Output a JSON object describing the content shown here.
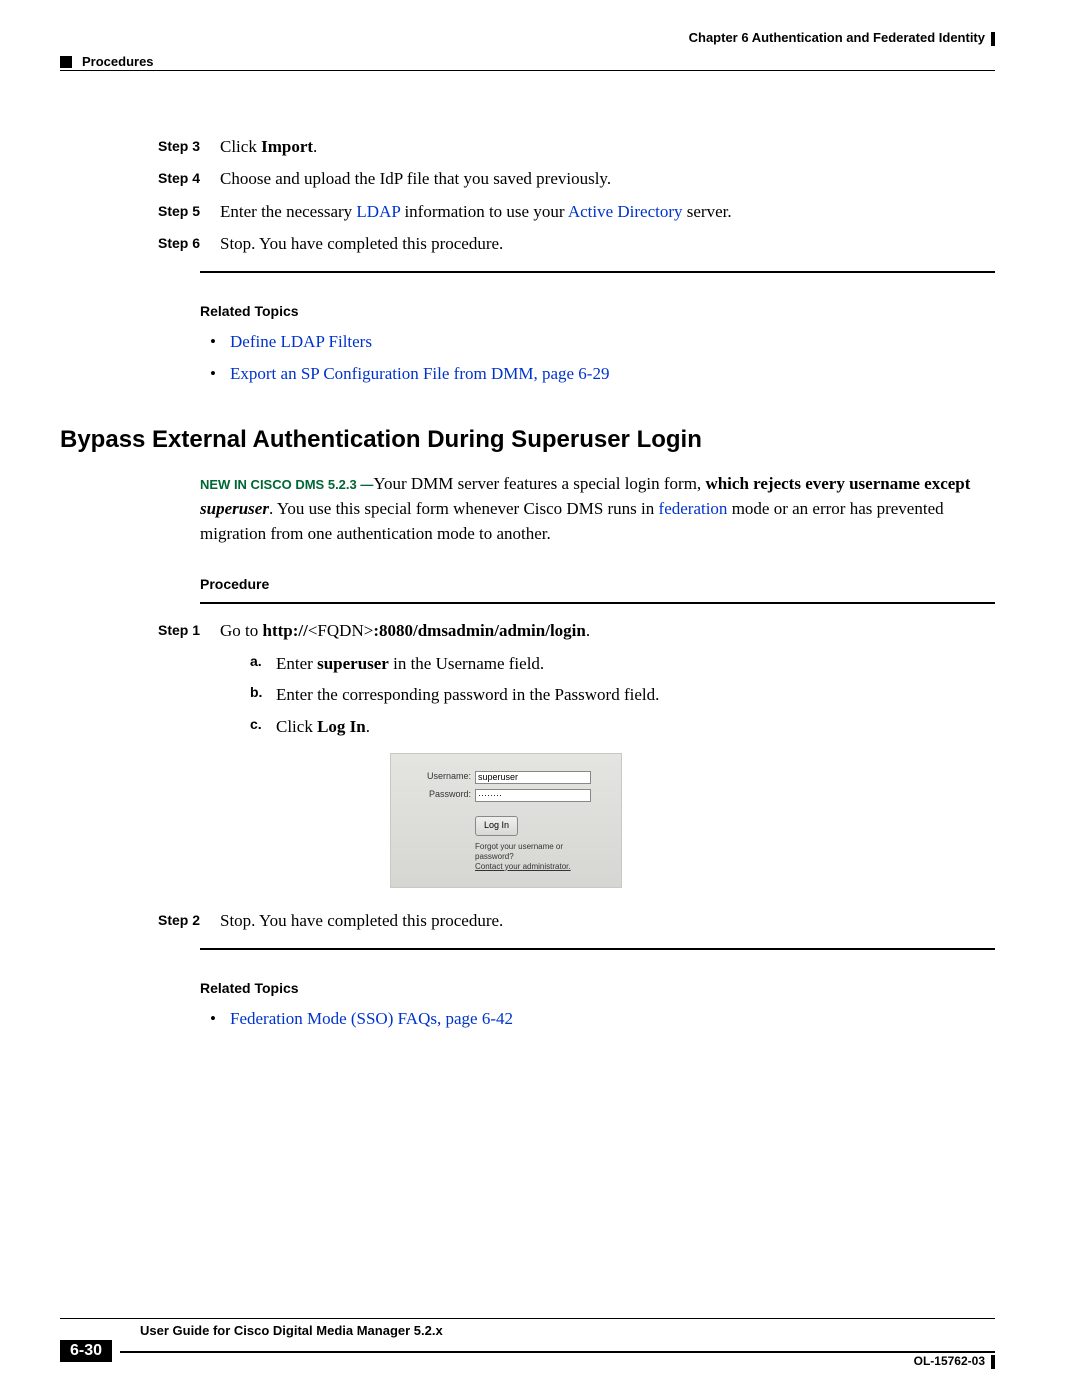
{
  "header": {
    "chapter": "Chapter 6      Authentication and Federated Identity",
    "section": "Procedures"
  },
  "steps_top": [
    {
      "label": "Step 3",
      "text": "Click ",
      "bold": "Import",
      "after": "."
    },
    {
      "label": "Step 4",
      "text": "Choose and upload the IdP file that you saved previously."
    },
    {
      "label": "Step 5",
      "text": "Enter the necessary ",
      "link1": "LDAP",
      "mid": " information to use your ",
      "link2": "Active Directory",
      "after": " server."
    },
    {
      "label": "Step 6",
      "text": "Stop. You have completed this procedure."
    }
  ],
  "related1": {
    "heading": "Related Topics",
    "items": [
      "Define LDAP Filters",
      "Export an SP Configuration File from DMM, page 6-29"
    ]
  },
  "section_title": "Bypass External Authentication During Superuser Login",
  "intro": {
    "new_tag": "NEW IN CISCO DMS 5.2.3 —",
    "t1": "Your DMM server features a special login form, ",
    "b1": "which rejects every username except ",
    "bi1": "superuser",
    "t2": ". You use this special form whenever Cisco DMS runs in ",
    "link": "federation",
    "t3": " mode or an error has prevented migration from one authentication mode to another."
  },
  "procedure_heading": "Procedure",
  "step1": {
    "label": "Step 1",
    "pre": "Go to ",
    "bold1": "http://",
    "plain": "<FQDN>",
    "bold2": ":8080/dmsadmin/admin/login",
    "after": ".",
    "sub": [
      {
        "m": "a.",
        "t1": "Enter ",
        "b": "superuser",
        "t2": " in the Username field."
      },
      {
        "m": "b.",
        "t1": "Enter the corresponding password in the Password field."
      },
      {
        "m": "c.",
        "t1": "Click ",
        "b": "Log In",
        "t2": "."
      }
    ]
  },
  "login_mock": {
    "username_label": "Username:",
    "username_value": "superuser",
    "password_label": "Password:",
    "password_value": "········",
    "button": "Log In",
    "help1": "Forgot your username or password?",
    "help2": "Contact your administrator."
  },
  "step2": {
    "label": "Step 2",
    "text": "Stop. You have completed this procedure."
  },
  "related2": {
    "heading": "Related Topics",
    "items": [
      "Federation Mode (SSO) FAQs, page 6-42"
    ]
  },
  "footer": {
    "title": "User Guide for Cisco Digital Media Manager 5.2.x",
    "page": "6-30",
    "doc_id": "OL-15762-03"
  }
}
